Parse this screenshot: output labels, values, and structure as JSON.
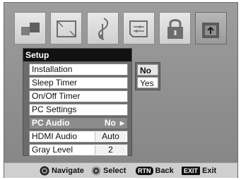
{
  "menu": {
    "title": "Setup",
    "items": [
      {
        "label": "Installation",
        "value": ""
      },
      {
        "label": "Sleep Timer",
        "value": ""
      },
      {
        "label": "On/Off Timer",
        "value": ""
      },
      {
        "label": "PC Settings",
        "value": ""
      },
      {
        "label": "PC Audio",
        "value": "No",
        "selected": true
      },
      {
        "label": "HDMI Audio",
        "value": "Auto"
      },
      {
        "label": "Gray Level",
        "value": "2"
      }
    ]
  },
  "submenu": {
    "options": [
      "No",
      "Yes"
    ],
    "selected": "No"
  },
  "tabs": [
    {
      "icon": "picture-icon"
    },
    {
      "icon": "screen-icon"
    },
    {
      "icon": "audio-icon"
    },
    {
      "icon": "preferences-icon"
    },
    {
      "icon": "lock-icon"
    },
    {
      "icon": "setup-icon",
      "active": true
    }
  ],
  "navbar": {
    "navigate": "Navigate",
    "select": "Select",
    "back_key": "RTN",
    "back": "Back",
    "exit_key": "EXIT",
    "exit": "Exit"
  }
}
